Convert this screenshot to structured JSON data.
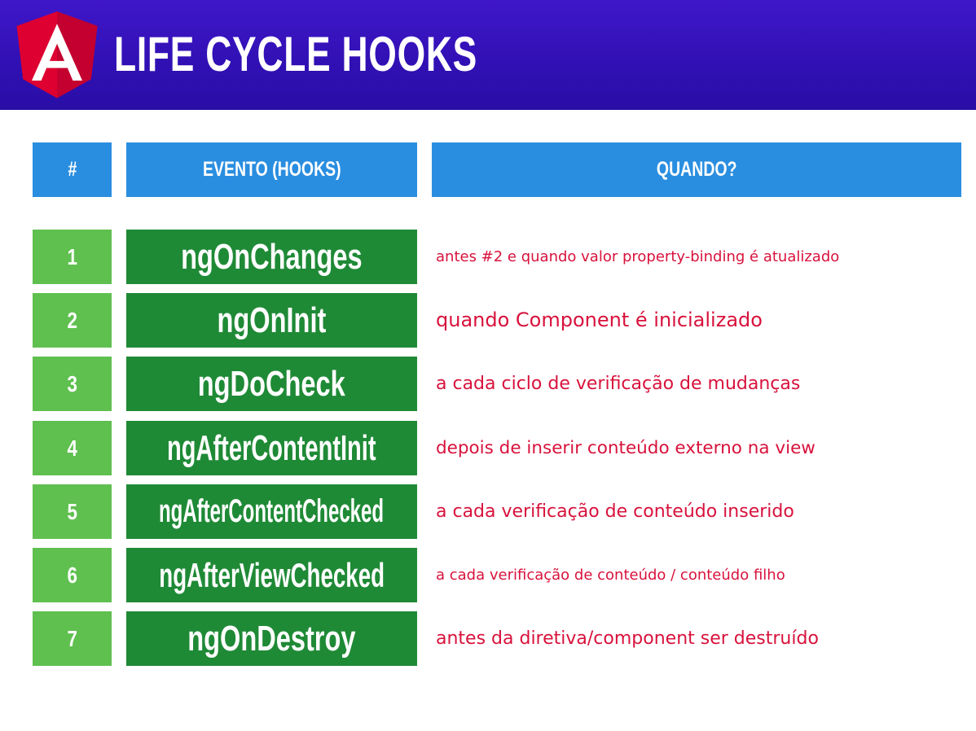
{
  "header": {
    "title": "LIFE CYCLE HOOKS",
    "logo_icon": "angular-logo-icon",
    "logo_letter": "A",
    "colors": {
      "background": "#3a14c0",
      "logo_red_light": "#dd0031",
      "logo_red_dark": "#c3002f"
    }
  },
  "table": {
    "columns": [
      "#",
      "EVENTO (HOOKS)",
      "QUANDO?"
    ],
    "rows": [
      {
        "num": "1",
        "hook": "ngOnChanges",
        "when": "antes #2 e quando valor property-binding é atualizado"
      },
      {
        "num": "2",
        "hook": "ngOnInit",
        "when": "quando Component é inicializado"
      },
      {
        "num": "3",
        "hook": "ngDoCheck",
        "when": "a cada ciclo de verificação de mudanças"
      },
      {
        "num": "4",
        "hook": "ngAfterContentInit",
        "when": "depois de inserir conteúdo externo na view"
      },
      {
        "num": "5",
        "hook": "ngAfterContentChecked",
        "when": "a cada verificação de conteúdo inserido"
      },
      {
        "num": "6",
        "hook": "ngAfterViewChecked",
        "when": "a cada verificação de conteúdo / conteúdo filho"
      },
      {
        "num": "7",
        "hook": "ngOnDestroy",
        "when": "antes da diretiva/component ser destruído"
      }
    ],
    "colors": {
      "header_bg": "#2a8ee0",
      "num_bg": "#5fc04f",
      "hook_bg": "#1f8a36",
      "description": "#d8123c"
    }
  }
}
